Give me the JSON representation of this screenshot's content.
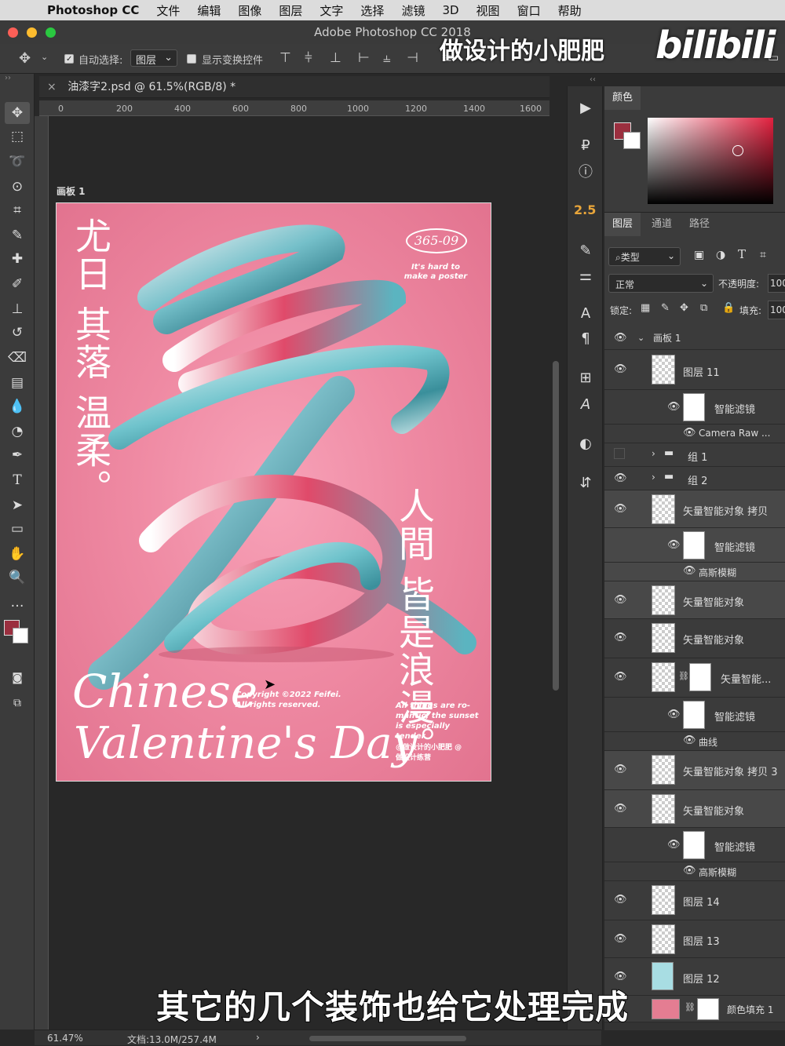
{
  "menubar": {
    "app_name": "Photoshop CC",
    "items": [
      "文件",
      "编辑",
      "图像",
      "图层",
      "文字",
      "选择",
      "滤镜",
      "3D",
      "视图",
      "窗口",
      "帮助"
    ]
  },
  "window": {
    "title": "Adobe Photoshop CC 2018"
  },
  "options": {
    "auto_select_label": "自动选择:",
    "auto_select_target": "图层",
    "show_transform_label": "显示变换控件"
  },
  "document": {
    "tab_title": "油漆字2.psd @ 61.5%(RGB/8) *",
    "artboard_label": "画板 1",
    "ruler_marks": [
      "0",
      "200",
      "400",
      "600",
      "800",
      "1000",
      "1200",
      "1400",
      "1600"
    ],
    "zoom": "61.47%",
    "doc_size": "文档:13.0M/257.4M"
  },
  "poster": {
    "title_left": "尤日 其落 温柔。",
    "badge": "365-09",
    "tagline": "It's hard to make a poster",
    "title_right": "人間 皆是浪漫。",
    "script_line1": "Chinese",
    "script_line2": "Valentine's Day",
    "copyright": "Copyright ©2022 Feifei. All rights reserved.",
    "blurb": "All things are ro- mantic, the sunset is especially tender",
    "handles": "@做设计的小肥肥 @做设计练营"
  },
  "right_column": {
    "value_badge": "2.5"
  },
  "color_panel": {
    "tab": "颜色",
    "foreground": "#9b2f3f",
    "background": "#ffffff"
  },
  "layers_panel": {
    "tabs": [
      "图层",
      "通道",
      "路径"
    ],
    "filter_kind": "类型",
    "blend_mode": "正常",
    "opacity_label": "不透明度:",
    "opacity_value": "100",
    "lock_label": "锁定:",
    "fill_label": "填充:",
    "fill_value": "100",
    "artboard": "画板 1",
    "layers": [
      {
        "name": "图层 11"
      },
      {
        "name": "智能滤镜"
      },
      {
        "name": "Camera Raw ..."
      },
      {
        "name": "组 1"
      },
      {
        "name": "组 2"
      },
      {
        "name": "矢量智能对象 拷贝"
      },
      {
        "name": "智能滤镜"
      },
      {
        "name": "高斯模糊"
      },
      {
        "name": "矢量智能对象"
      },
      {
        "name": "矢量智能对象"
      },
      {
        "name": "矢量智能..."
      },
      {
        "name": "智能滤镜"
      },
      {
        "name": "曲线"
      },
      {
        "name": "矢量智能对象 拷贝 3"
      },
      {
        "name": "矢量智能对象"
      },
      {
        "name": "智能滤镜"
      },
      {
        "name": "高斯模糊"
      },
      {
        "name": "图层 14"
      },
      {
        "name": "图层 13"
      },
      {
        "name": "图层 12"
      },
      {
        "name": "颜色填充 1"
      }
    ]
  },
  "overlay": {
    "watermark": "做设计的小肥肥",
    "platform_logo": "bilibili",
    "subtitle": "其它的几个装饰也给它处理完成"
  }
}
